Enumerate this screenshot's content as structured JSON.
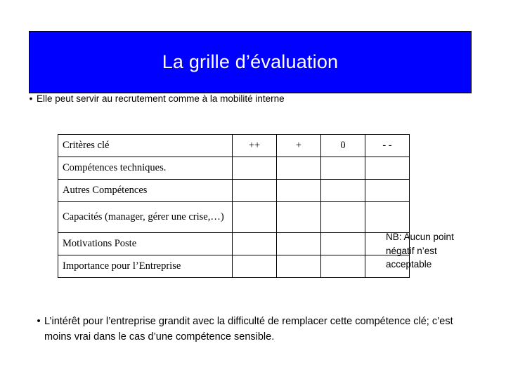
{
  "slide": {
    "title": "La grille d’évaluation",
    "title_bg_color": "#0000FF",
    "title_text_color": "#FFFFFF",
    "bullet_marker": "•",
    "intro_bullet": "Elle peut servir au recrutement comme à la mobilité interne",
    "note": "NB: Aucun point négatif n’est acceptable",
    "closing_bullet": "L’intérêt pour l’entreprise grandit avec la difficulté de remplacer cette compétence clé; c’est moins vrai dans le cas d’une compétence sensible."
  },
  "table": {
    "headers": {
      "criteria": "Critères clé",
      "mark_1": "++",
      "mark_2": "+",
      "mark_3": "0",
      "mark_4": "- -"
    },
    "rows": [
      {
        "label": "Compétences techniques."
      },
      {
        "label": "Autres Compétences"
      },
      {
        "label": "Capacités (manager, gérer une crise,…)"
      },
      {
        "label": "Motivations Poste"
      },
      {
        "label": "Importance pour l’Entreprise"
      }
    ]
  }
}
